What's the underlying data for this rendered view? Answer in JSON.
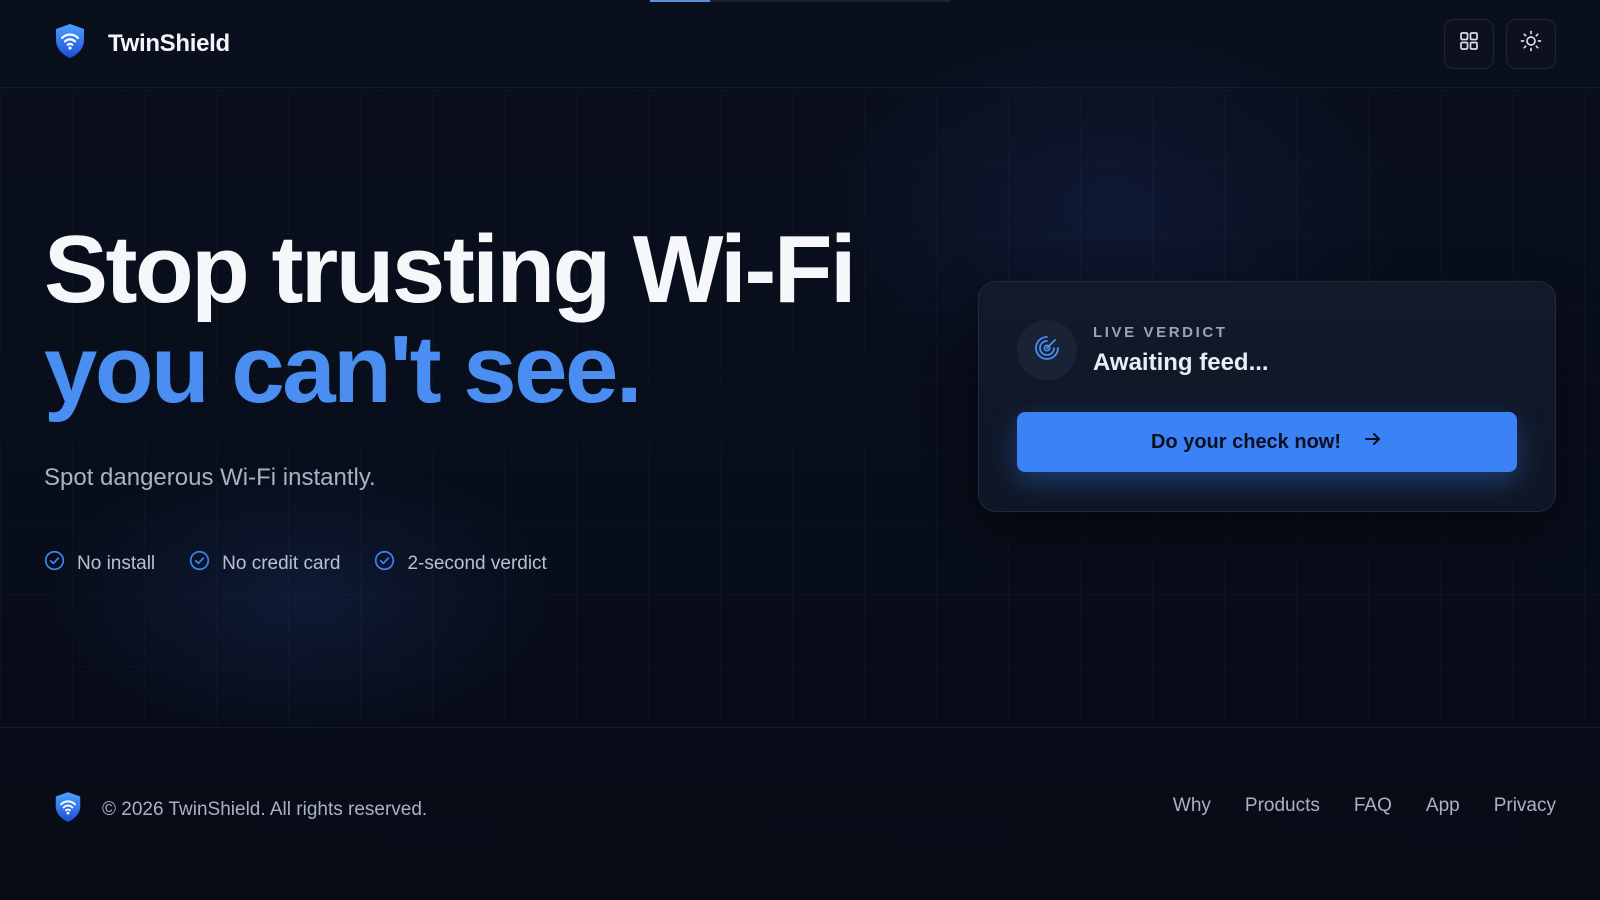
{
  "header": {
    "brand_name": "TwinShield"
  },
  "progress": {
    "fraction": 0.2
  },
  "hero": {
    "headline_line1": "Stop trusting Wi-Fi",
    "headline_line2": "you can't see.",
    "subtitle": "Spot dangerous Wi-Fi instantly.",
    "features": [
      {
        "label": "No install"
      },
      {
        "label": "No credit card"
      },
      {
        "label": "2-second verdict"
      }
    ]
  },
  "verdict_card": {
    "label": "LIVE VERDICT",
    "status": "Awaiting feed...",
    "cta_label": "Do your check now!"
  },
  "footer": {
    "copyright": "© 2026 TwinShield. All rights reserved.",
    "links": [
      {
        "label": "Why"
      },
      {
        "label": "Products"
      },
      {
        "label": "FAQ"
      },
      {
        "label": "App"
      },
      {
        "label": "Privacy"
      }
    ]
  },
  "colors": {
    "accent": "#3b82f6",
    "headline_highlight": "#4b8ef2",
    "background": "#070b16"
  },
  "icons": {
    "logo": "shield-wifi-icon",
    "apps": "grid-icon",
    "theme": "sun-icon",
    "radar": "radar-icon",
    "feature": "check-circle-icon",
    "cta": "arrow-right-icon"
  }
}
